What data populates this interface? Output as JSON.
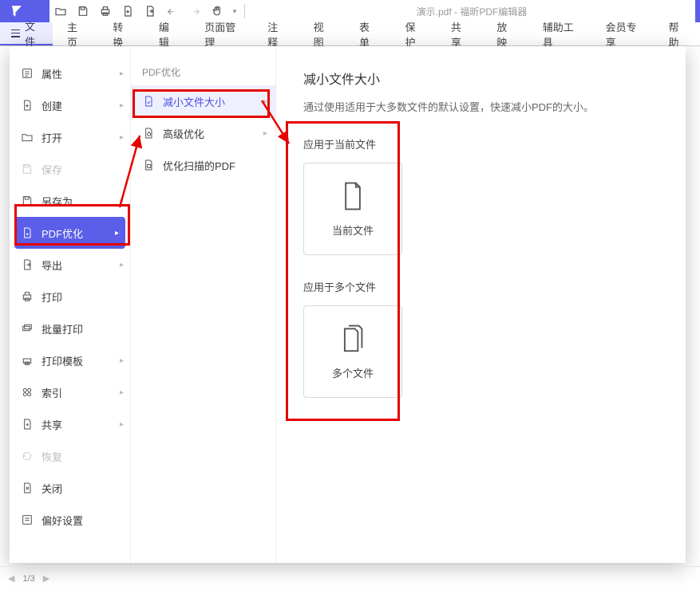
{
  "app": {
    "document_title": "演示.pdf - 福昕PDF编辑器"
  },
  "ribbon": {
    "file": "文件",
    "tabs": [
      "主页",
      "转换",
      "编辑",
      "页面管理",
      "注释",
      "视图",
      "表单",
      "保护",
      "共享",
      "放映",
      "辅助工具",
      "会员专享",
      "帮助"
    ]
  },
  "file_menu": {
    "items": [
      {
        "label": "属性",
        "has_sub": true
      },
      {
        "label": "创建",
        "has_sub": true
      },
      {
        "label": "打开",
        "has_sub": true
      },
      {
        "label": "保存",
        "has_sub": false,
        "disabled": true
      },
      {
        "label": "另存为",
        "has_sub": true
      },
      {
        "label": "PDF优化",
        "has_sub": true,
        "active": true
      },
      {
        "label": "导出",
        "has_sub": true
      },
      {
        "label": "打印",
        "has_sub": false
      },
      {
        "label": "批量打印",
        "has_sub": false
      },
      {
        "label": "打印模板",
        "has_sub": true
      },
      {
        "label": "索引",
        "has_sub": true
      },
      {
        "label": "共享",
        "has_sub": true
      },
      {
        "label": "恢复",
        "has_sub": false,
        "disabled": true
      },
      {
        "label": "关闭",
        "has_sub": false
      },
      {
        "label": "偏好设置",
        "has_sub": false
      }
    ]
  },
  "pdf_optimize": {
    "title": "PDF优化",
    "items": [
      {
        "label": "减小文件大小",
        "active": true,
        "has_sub": true
      },
      {
        "label": "高级优化",
        "has_sub": true
      },
      {
        "label": "优化扫描的PDF",
        "has_sub": false
      }
    ]
  },
  "reduce_panel": {
    "heading": "减小文件大小",
    "desc": "通过使用适用于大多数文件的默认设置，快速减小PDF的大小。",
    "sect1": "应用于当前文件",
    "card1": "当前文件",
    "sect2": "应用于多个文件",
    "card2": "多个文件"
  },
  "status": {
    "page": "1/3"
  }
}
